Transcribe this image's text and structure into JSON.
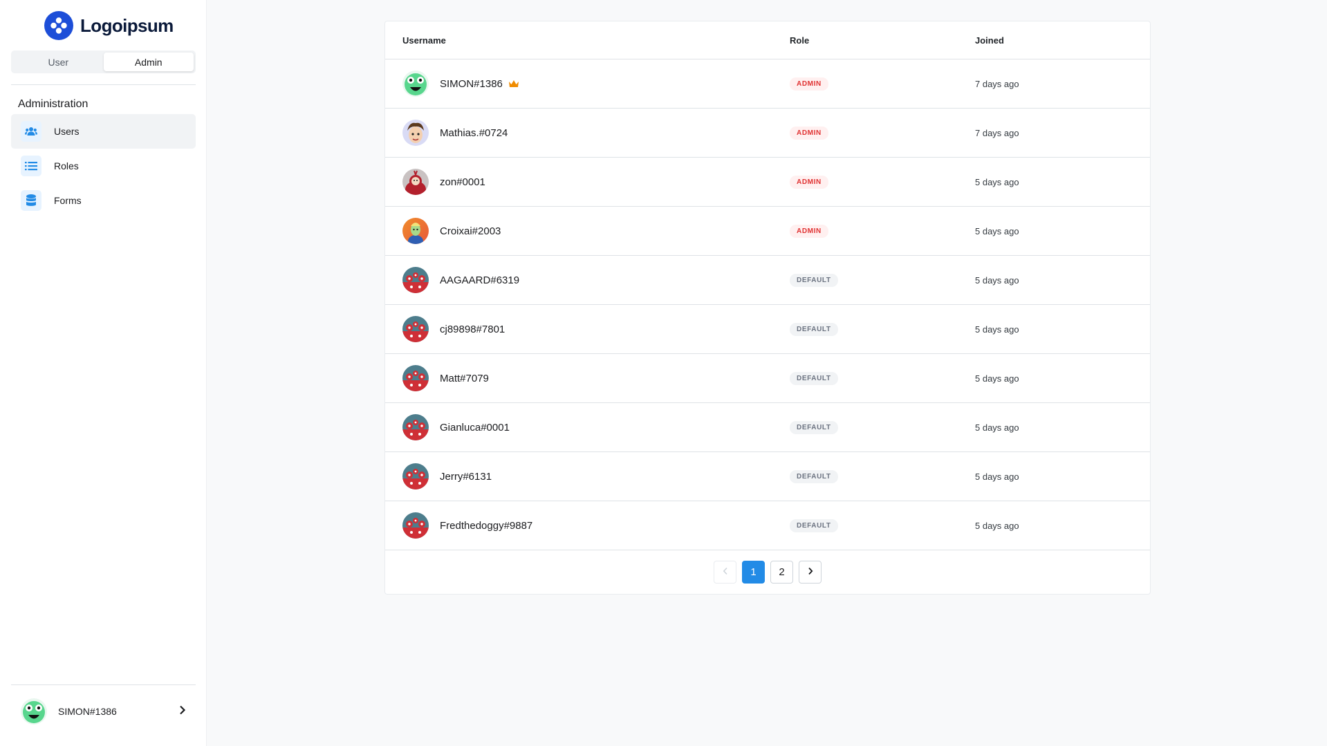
{
  "brand": {
    "name": "Logoipsum",
    "color": "#1d4ed8"
  },
  "mode_switch": {
    "options": [
      "User",
      "Admin"
    ],
    "selected": "Admin"
  },
  "sidebar": {
    "section_title": "Administration",
    "items": [
      {
        "label": "Users",
        "icon": "users-icon",
        "active": true
      },
      {
        "label": "Roles",
        "icon": "list-icon",
        "active": false
      },
      {
        "label": "Forms",
        "icon": "database-icon",
        "active": false
      }
    ]
  },
  "current_user": {
    "name": "SIMON#1386",
    "icon": "chevron-right-icon"
  },
  "table": {
    "headers": {
      "username": "Username",
      "role": "Role",
      "joined": "Joined"
    },
    "rows": [
      {
        "username": "SIMON#1386",
        "role": "ADMIN",
        "joined": "7 days ago",
        "owner": true,
        "icon": "crown-icon"
      },
      {
        "username": "Mathias.#0724",
        "role": "ADMIN",
        "joined": "7 days ago"
      },
      {
        "username": "zon#0001",
        "role": "ADMIN",
        "joined": "5 days ago"
      },
      {
        "username": "Croixai#2003",
        "role": "ADMIN",
        "joined": "5 days ago"
      },
      {
        "username": "AAGAARD#6319",
        "role": "DEFAULT",
        "joined": "5 days ago"
      },
      {
        "username": "cj89898#7801",
        "role": "DEFAULT",
        "joined": "5 days ago"
      },
      {
        "username": "Matt#7079",
        "role": "DEFAULT",
        "joined": "5 days ago"
      },
      {
        "username": "Gianluca#0001",
        "role": "DEFAULT",
        "joined": "5 days ago"
      },
      {
        "username": "Jerry#6131",
        "role": "DEFAULT",
        "joined": "5 days ago"
      },
      {
        "username": "Fredthedoggy#9887",
        "role": "DEFAULT",
        "joined": "5 days ago"
      }
    ]
  },
  "pagination": {
    "pages": [
      "1",
      "2"
    ],
    "current": "1",
    "prev_icon": "chevron-left-icon",
    "next_icon": "chevron-right-icon"
  },
  "colors": {
    "accent": "#228be6",
    "admin_badge": "#e03131",
    "default_badge": "#6b7280",
    "crown": "#f08c00"
  }
}
